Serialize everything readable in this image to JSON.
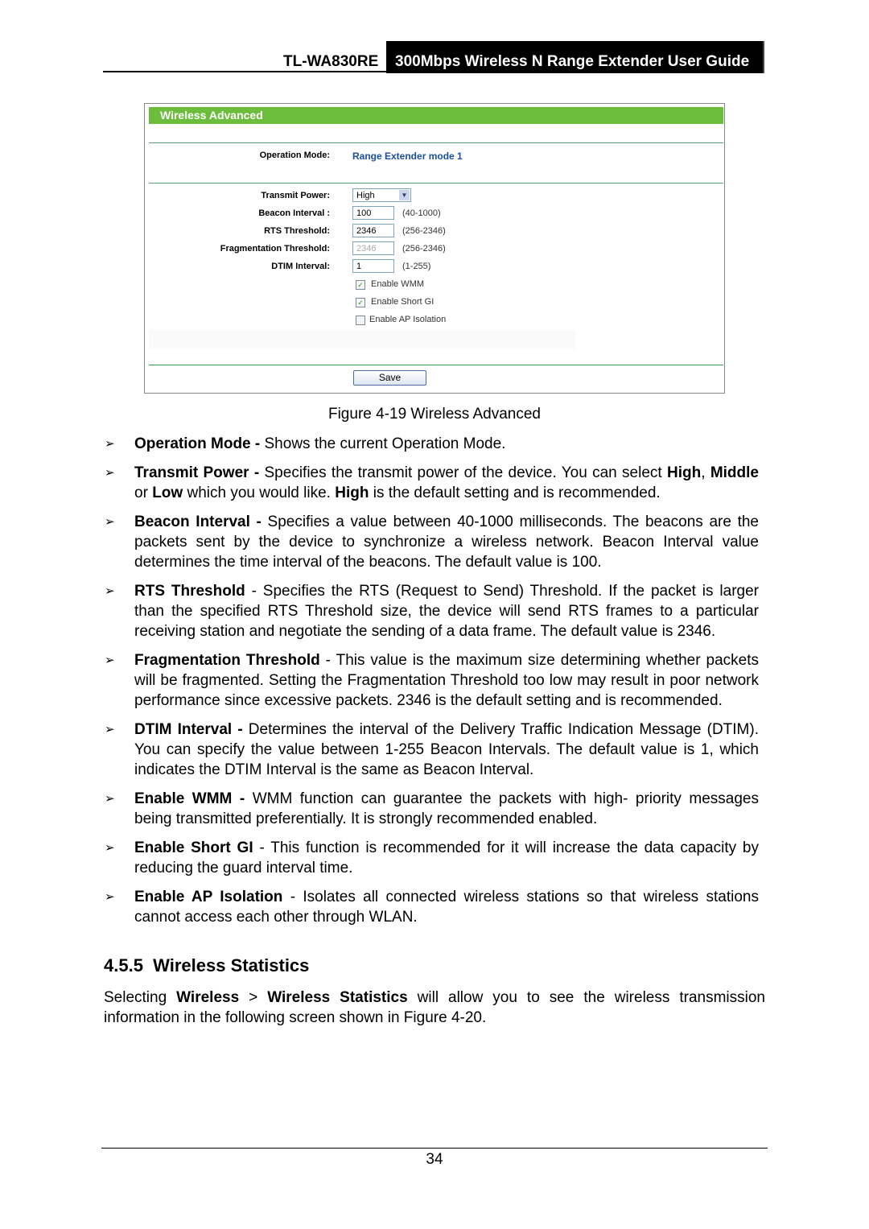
{
  "header": {
    "model": "TL-WA830RE",
    "title": "300Mbps Wireless N Range Extender User Guide"
  },
  "screenshot": {
    "title": "Wireless Advanced",
    "operation_mode_label": "Operation Mode:",
    "operation_mode_value": "Range Extender mode 1",
    "transmit_power_label": "Transmit Power:",
    "transmit_power_value": "High",
    "beacon_label": "Beacon Interval :",
    "beacon_value": "100",
    "beacon_range": "(40-1000)",
    "rts_label": "RTS Threshold:",
    "rts_value": "2346",
    "rts_range": "(256-2346)",
    "frag_label": "Fragmentation Threshold:",
    "frag_value": "2346",
    "frag_range": "(256-2346)",
    "dtim_label": "DTIM Interval:",
    "dtim_value": "1",
    "dtim_range": "(1-255)",
    "wmm_label": "Enable WMM",
    "wmm_checked": true,
    "sgi_label": "Enable Short GI",
    "sgi_checked": true,
    "apiso_label": "Enable AP Isolation",
    "apiso_checked": false,
    "save_label": "Save"
  },
  "caption": "Figure 4-19 Wireless Advanced",
  "bullets": [
    [
      {
        "b": true,
        "t": "Operation Mode -"
      },
      {
        "t": " Shows the current Operation Mode."
      }
    ],
    [
      {
        "b": true,
        "t": "Transmit Power -"
      },
      {
        "t": " Specifies the transmit power of the device. You can select "
      },
      {
        "b": true,
        "t": "High"
      },
      {
        "t": ", "
      },
      {
        "b": true,
        "t": "Middle"
      },
      {
        "t": " or "
      },
      {
        "b": true,
        "t": "Low"
      },
      {
        "t": " which you would like. "
      },
      {
        "b": true,
        "t": "High"
      },
      {
        "t": " is the default setting and is recommended."
      }
    ],
    [
      {
        "b": true,
        "t": "Beacon Interval -"
      },
      {
        "t": " Specifies a value between 40-1000 milliseconds. The beacons are the packets sent by the device to synchronize a wireless network. Beacon Interval value determines the time interval of the beacons. The default value is 100."
      }
    ],
    [
      {
        "b": true,
        "t": "RTS Threshold"
      },
      {
        "t": " - Specifies the RTS (Request to Send) Threshold. If the packet is larger than the specified RTS Threshold size, the device will send RTS frames to a particular receiving station and negotiate the sending of a data frame. The default value is 2346."
      }
    ],
    [
      {
        "b": true,
        "t": "Fragmentation Threshold"
      },
      {
        "t": " - This value is the maximum size determining whether packets will be fragmented. Setting the Fragmentation Threshold too low may result in poor network performance since excessive packets. 2346 is the default setting and is recommended."
      }
    ],
    [
      {
        "b": true,
        "t": "DTIM Interval -"
      },
      {
        "t": " Determines the interval of the Delivery Traffic Indication Message (DTIM). You can specify the value between 1-255 Beacon Intervals. The default value is 1, which indicates the DTIM Interval is the same as Beacon Interval."
      }
    ],
    [
      {
        "b": true,
        "t": "Enable WMM -"
      },
      {
        "t": " WMM function can guarantee the packets with high- priority messages being transmitted preferentially. It is strongly recommended enabled."
      }
    ],
    [
      {
        "b": true,
        "t": "Enable Short GI"
      },
      {
        "t": " - This function is recommended for it will increase the data capacity by reducing the guard interval time."
      }
    ],
    [
      {
        "b": true,
        "t": "Enable AP Isolation"
      },
      {
        "t": " - Isolates all connected wireless stations so that wireless stations cannot access each other through WLAN."
      }
    ]
  ],
  "section": {
    "number": "4.5.5",
    "title": "Wireless Statistics"
  },
  "paragraph": [
    {
      "t": "Selecting "
    },
    {
      "b": true,
      "t": "Wireless"
    },
    {
      "t": " > "
    },
    {
      "b": true,
      "t": "Wireless Statistics"
    },
    {
      "t": " will allow you to see the wireless transmission information in the following screen shown in Figure 4-20."
    }
  ],
  "page_number": "34"
}
